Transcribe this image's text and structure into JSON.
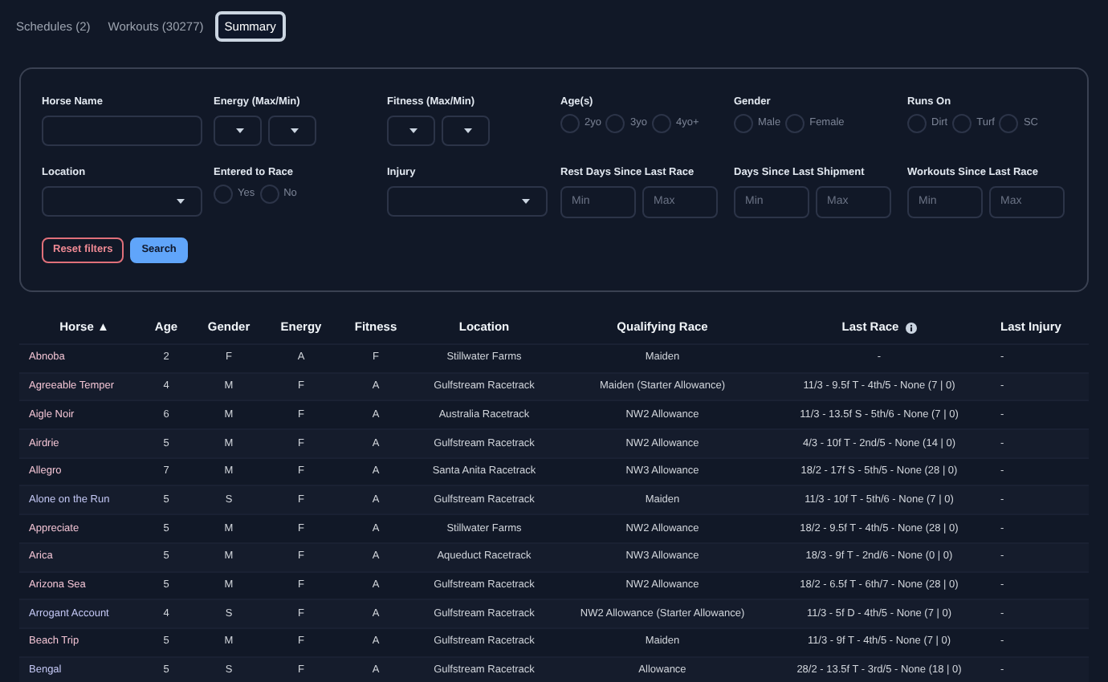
{
  "tabs": [
    {
      "label": "Schedules (2)",
      "selected": false
    },
    {
      "label": "Workouts (30277)",
      "selected": false
    },
    {
      "label": "Summary",
      "selected": true
    }
  ],
  "filters": [
    {
      "kind": "text",
      "label": "Horse Name"
    },
    {
      "kind": "select_pair",
      "label": "Energy (Max/Min)"
    },
    {
      "kind": "select_pair",
      "label": "Fitness (Max/Min)"
    },
    {
      "kind": "radio",
      "label": "Age(s)",
      "options": [
        {
          "label": "2yo",
          "selected": false
        },
        {
          "label": "3yo",
          "selected": false
        },
        {
          "label": "4yo+",
          "selected": false
        }
      ]
    },
    {
      "kind": "radio",
      "label": "Gender",
      "options": [
        {
          "label": "Male",
          "selected": false
        },
        {
          "label": "Female",
          "selected": false
        }
      ]
    },
    {
      "kind": "radio",
      "label": "Runs On",
      "options": [
        {
          "label": "Dirt",
          "selected": false
        },
        {
          "label": "Turf",
          "selected": false
        },
        {
          "label": "SC",
          "selected": false
        }
      ]
    },
    {
      "kind": "select",
      "label": "Location"
    },
    {
      "kind": "radio",
      "label": "Entered to Race",
      "options": [
        {
          "label": "Yes",
          "selected": false
        },
        {
          "label": "No",
          "selected": false
        }
      ]
    },
    {
      "kind": "select",
      "label": "Injury"
    },
    {
      "kind": "min_max",
      "label": "Rest Days Since Last Race",
      "min_placeholder": "Min",
      "max_placeholder": "Max"
    },
    {
      "kind": "min_max",
      "label": "Days Since Last Shipment",
      "min_placeholder": "Min",
      "max_placeholder": "Max"
    },
    {
      "kind": "min_max",
      "label": "Workouts Since Last Race",
      "min_placeholder": "Min",
      "max_placeholder": "Max"
    }
  ],
  "buttons": [
    {
      "label": "Reset filters",
      "kind": "reset"
    },
    {
      "label": "Search",
      "kind": "primary"
    }
  ],
  "table": {
    "columns": [
      "Horse ▲",
      "Age",
      "Gender",
      "Energy",
      "Fitness",
      "Location",
      "Qualifying Race",
      "Last Race",
      "Last Injury"
    ],
    "rows": [
      {
        "color": "#f2c4d4",
        "cells": [
          "Abnoba",
          "2",
          "F",
          "A",
          "F",
          "Stillwater Farms",
          "Maiden",
          "-",
          "-"
        ]
      },
      {
        "color": "#f2c4d4",
        "cells": [
          "Agreeable Temper",
          "4",
          "M",
          "F",
          "A",
          "Gulfstream Racetrack",
          "Maiden (Starter Allowance)",
          "11/3 - 9.5f T - 4th/5 - None (7 | 0)",
          "-"
        ]
      },
      {
        "color": "#f2c4d4",
        "cells": [
          "Aigle Noir",
          "6",
          "M",
          "F",
          "A",
          "Australia Racetrack",
          "NW2 Allowance",
          "11/3 - 13.5f S - 5th/6 - None (7 | 0)",
          "-"
        ]
      },
      {
        "color": "#f2c4d4",
        "cells": [
          "Airdrie",
          "5",
          "M",
          "F",
          "A",
          "Gulfstream Racetrack",
          "NW2 Allowance",
          "4/3 - 10f T - 2nd/5 - None (14 | 0)",
          "-"
        ]
      },
      {
        "color": "#f2c4d4",
        "cells": [
          "Allegro",
          "7",
          "M",
          "F",
          "A",
          "Santa Anita Racetrack",
          "NW3 Allowance",
          "18/2 - 17f S - 5th/5 - None (28 | 0)",
          "-"
        ]
      },
      {
        "color": "#c4c8f5",
        "cells": [
          "Alone on the Run",
          "5",
          "S",
          "F",
          "A",
          "Gulfstream Racetrack",
          "Maiden",
          "11/3 - 10f T - 5th/6 - None (7 | 0)",
          "-"
        ]
      },
      {
        "color": "#f2c4d4",
        "cells": [
          "Appreciate",
          "5",
          "M",
          "F",
          "A",
          "Stillwater Farms",
          "NW2 Allowance",
          "18/2 - 9.5f T - 4th/5 - None (28 | 0)",
          "-"
        ]
      },
      {
        "color": "#f2c4d4",
        "cells": [
          "Arica",
          "5",
          "M",
          "F",
          "A",
          "Aqueduct Racetrack",
          "NW3 Allowance",
          "18/3 - 9f T - 2nd/6 - None (0 | 0)",
          "-"
        ]
      },
      {
        "color": "#f2c4d4",
        "cells": [
          "Arizona Sea",
          "5",
          "M",
          "F",
          "A",
          "Gulfstream Racetrack",
          "NW2 Allowance",
          "18/2 - 6.5f T - 6th/7 - None (28 | 0)",
          "-"
        ]
      },
      {
        "color": "#c4c8f5",
        "cells": [
          "Arrogant Account",
          "4",
          "S",
          "F",
          "A",
          "Gulfstream Racetrack",
          "NW2 Allowance (Starter Allowance)",
          "11/3 - 5f D - 4th/5 - None (7 | 0)",
          "-"
        ]
      },
      {
        "color": "#f2c4d4",
        "cells": [
          "Beach Trip",
          "5",
          "M",
          "F",
          "A",
          "Gulfstream Racetrack",
          "Maiden",
          "11/3 - 9f T - 4th/5 - None (7 | 0)",
          "-"
        ]
      },
      {
        "color": "#c4c8f5",
        "cells": [
          "Bengal",
          "5",
          "S",
          "F",
          "A",
          "Gulfstream Racetrack",
          "Allowance",
          "28/2 - 13.5f T - 3rd/5 - None (18 | 0)",
          "-"
        ]
      }
    ]
  }
}
